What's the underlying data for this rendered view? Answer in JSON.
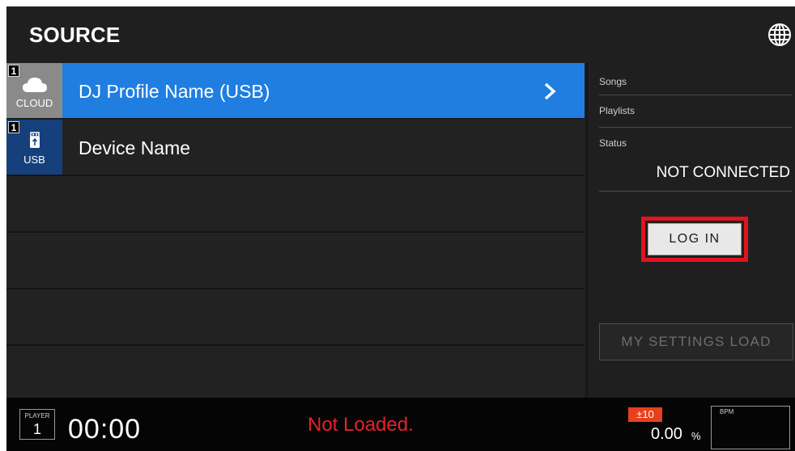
{
  "header": {
    "title": "SOURCE",
    "globe_icon": "globe-icon"
  },
  "sources": [
    {
      "badge": "1",
      "icon": "cloud-icon",
      "type_label": "CLOUD",
      "name": "DJ Profile Name (USB)",
      "selected": true
    },
    {
      "badge": "1",
      "icon": "usb-icon",
      "type_label": "USB",
      "name": "Device Name",
      "selected": false
    }
  ],
  "panel": {
    "songs_label": "Songs",
    "playlists_label": "Playlists",
    "status_label": "Status",
    "status_value": "NOT CONNECTED",
    "login_label": "LOG IN",
    "settings_label": "MY SETTINGS LOAD"
  },
  "footer": {
    "player_caption": "PLAYER",
    "player_number": "1",
    "time": "00:00",
    "load_status": "Not Loaded.",
    "tempo_range": "±10",
    "tempo_value": "0.00",
    "tempo_unit": "%",
    "bpm_caption": "BPM"
  },
  "colors": {
    "selected_row": "#1f7ee0",
    "cloud_tile": "#8a8a8a",
    "usb_tile": "#15407b",
    "highlight_outline": "#e0141e",
    "not_loaded_text": "#e8202a",
    "tempo_badge": "#e8401c"
  }
}
